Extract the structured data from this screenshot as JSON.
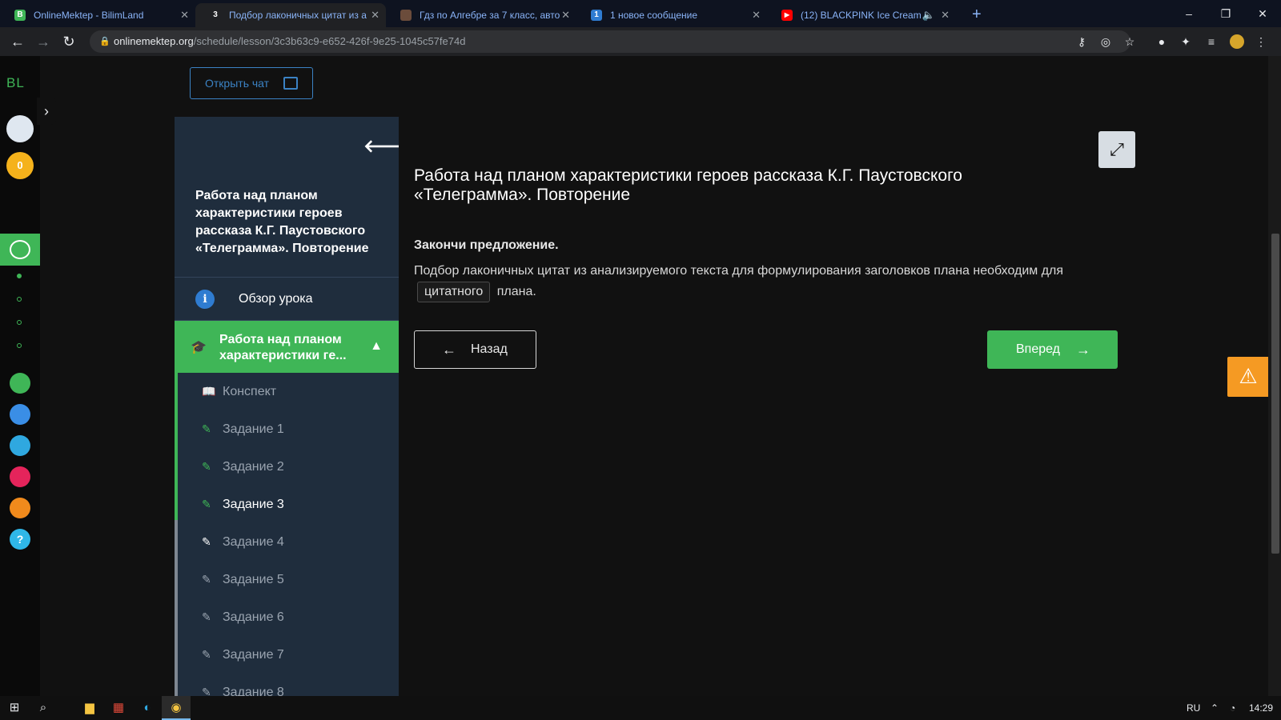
{
  "browser": {
    "tabs": [
      {
        "title": "OnlineMektep - BilimLand",
        "favicon": "bilimland-icon",
        "favicon_color": "#3fb657",
        "favicon_text": "B"
      },
      {
        "title": "Подбор лаконичных цитат из а",
        "favicon": "badge-3",
        "favicon_color": "#202124",
        "favicon_text": "3"
      },
      {
        "title": "Гдз по Алгебре за 7 класс, авто",
        "favicon": "site-icon",
        "favicon_color": "#6b4c3b",
        "favicon_text": ""
      },
      {
        "title": "1 новое сообщение",
        "favicon": "message-icon",
        "favicon_color": "#2f7cd1",
        "favicon_text": "1"
      },
      {
        "title": "(12) BLACKPINK Ice Cream (",
        "favicon": "youtube-icon",
        "favicon_color": "#ff0000",
        "favicon_text": "▶"
      }
    ],
    "url_host": "onlinemektep.org",
    "url_path": "/schedule/lesson/3c3b63c9-e652-426f-9e25-1045c57fe74d"
  },
  "page": {
    "rail": {
      "logo": "BL",
      "coins": "0"
    },
    "chat_button": "Открыть чат",
    "lesson_nav": {
      "title": "Работа над планом характеристики героев рассказа К.Г. Паустовского «Телеграмма». Повторение",
      "overview": "Обзор урока",
      "active_section": "Работа над планом характеристики ге...",
      "items": [
        {
          "label": "Конспект",
          "icon": "book-icon"
        },
        {
          "label": "Задание 1",
          "icon": "edit-icon"
        },
        {
          "label": "Задание 2",
          "icon": "edit-icon"
        },
        {
          "label": "Задание 3",
          "icon": "edit-icon"
        },
        {
          "label": "Задание 4",
          "icon": "edit-icon"
        },
        {
          "label": "Задание 5",
          "icon": "edit-icon"
        },
        {
          "label": "Задание 6",
          "icon": "edit-icon"
        },
        {
          "label": "Задание 7",
          "icon": "edit-icon"
        },
        {
          "label": "Задание 8",
          "icon": "edit-icon"
        }
      ]
    },
    "content": {
      "heading": "Работа над планом характеристики героев рассказа К.Г. Паустовского «Телеграмма». Повторение",
      "prompt": "Закончи предложение.",
      "sentence_before": "Подбор лаконичных цитат из анализируемого текста для формулирования заголовков плана необходим для",
      "blank_value": "цитатного",
      "sentence_after": "плана."
    },
    "buttons": {
      "back": "Назад",
      "forward": "Вперед"
    }
  },
  "taskbar": {
    "lang": "RU",
    "time": "14:29"
  },
  "colors": {
    "accent_green": "#3fb657",
    "nav_bg": "#1f2d3d",
    "chat_blue": "#3b82c4",
    "warn_orange": "#f59a23"
  }
}
